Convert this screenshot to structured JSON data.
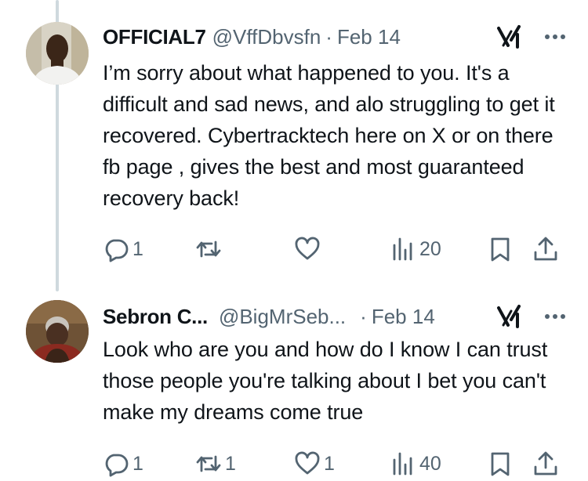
{
  "tweets": [
    {
      "name": "OFFICIAL7",
      "handle": "@VffDbvsfn",
      "separator": "·",
      "date": "Feb 14",
      "text": "I’m sorry about what happened to you. It's a difficult and sad news, and alo struggling to get it recovered. Cybertracktech here on X or on there fb page , gives the best and most guaranteed recovery back!",
      "reply_count": "1",
      "retweet_count": "",
      "like_count": "",
      "view_count": "20"
    },
    {
      "name": "Sebron C...",
      "handle": "@BigMrSeb...",
      "separator": "·",
      "date": "Feb 14",
      "text": "Look who are you and how do I know I can trust those people you're talking about I bet you can't make my dreams come true",
      "reply_count": "1",
      "retweet_count": "1",
      "like_count": "1",
      "view_count": "40"
    }
  ],
  "icons": {
    "reply": "reply-icon",
    "retweet": "retweet-icon",
    "like": "heart-icon",
    "views": "views-icon",
    "bookmark": "bookmark-icon",
    "share": "share-icon",
    "grok": "grok-icon",
    "more": "more-icon"
  },
  "colors": {
    "text": "#0f1419",
    "secondary": "#536471",
    "thread_line": "#cfd9de"
  }
}
